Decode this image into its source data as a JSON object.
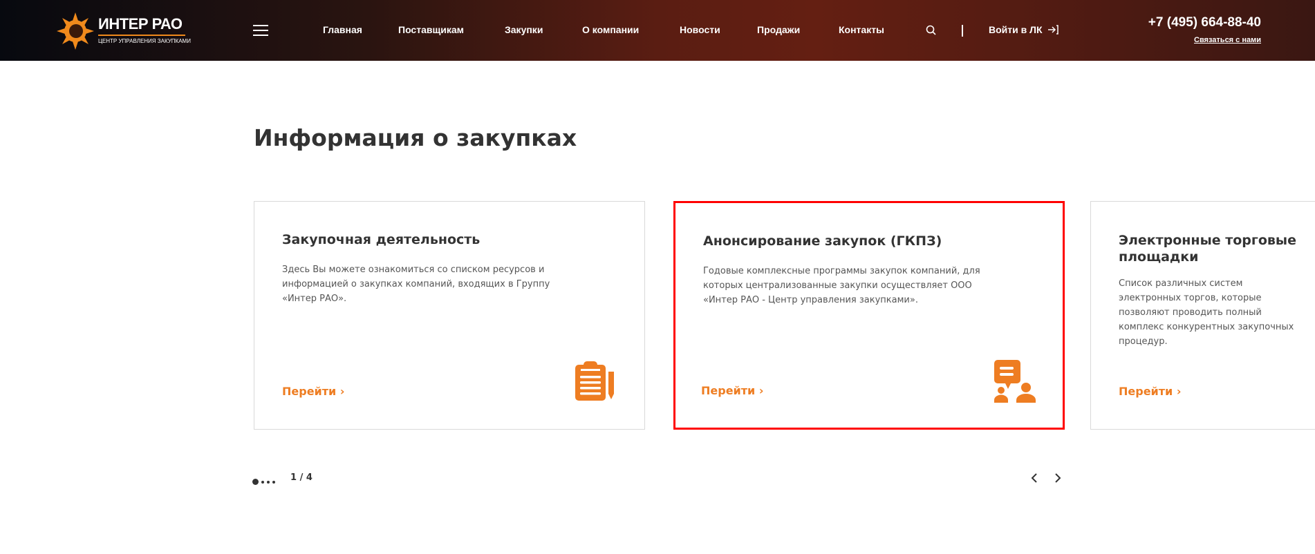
{
  "header": {
    "logo_text": "ИНТЕР РАО",
    "logo_subtitle": "ЦЕНТР УПРАВЛЕНИЯ ЗАКУПКАМИ",
    "nav": [
      "Главная",
      "Поставщикам",
      "Закупки",
      "О компании",
      "Новости",
      "Продажи",
      "Контакты"
    ],
    "login_label": "Войти в ЛК",
    "phone": "+7 (495) 664-88-40",
    "contact_link": "Связаться с нами"
  },
  "main": {
    "title": "Информация о закупках",
    "cards": [
      {
        "title": "Закупочная деятельность",
        "description": "Здесь Вы можете ознакомиться со списком ресурсов и информацией о закупках компаний, входящих в Группу «Интер РАО».",
        "link": "Перейти",
        "icon": "clipboard-icon"
      },
      {
        "title": "Анонсирование закупок (ГКПЗ)",
        "description": "Годовые комплексные программы закупок компаний, для которых централизованные закупки осуществляет ООО «Интер РАО - Центр управления закупками».",
        "link": "Перейти",
        "icon": "chat-users-icon",
        "highlighted": true
      },
      {
        "title": "Электронные торговые площадки",
        "description": "Список различных систем электронных торгов, которые позволяют проводить полный комплекс конкурентных закупочных процедур.",
        "link": "Перейти"
      }
    ],
    "pagination": {
      "label": "1 / 4",
      "current": 1,
      "total": 4
    }
  },
  "colors": {
    "accent": "#ee7d22",
    "highlight_border": "#ff0000",
    "text": "#333333"
  }
}
